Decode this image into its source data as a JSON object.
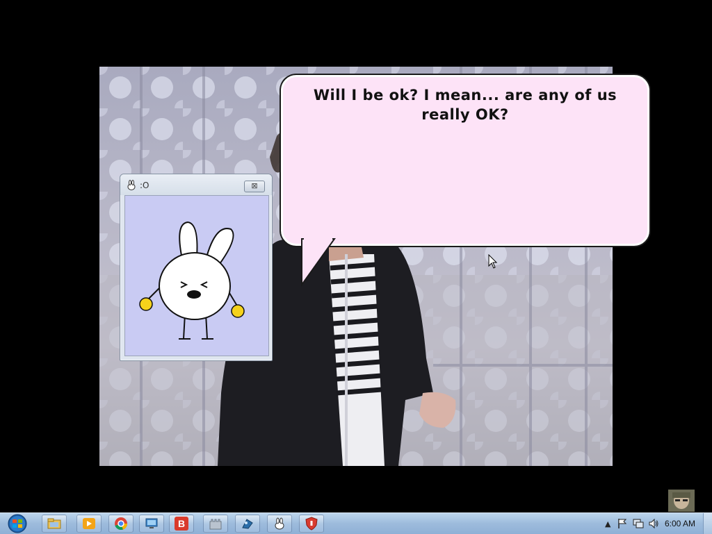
{
  "speech_bubble": {
    "text": "Will I be ok? I mean... are any of us really OK?"
  },
  "pet_window": {
    "title": ":O",
    "close_label": "⊠",
    "character": "white-bunny"
  },
  "taskbar": {
    "start_button": "start-orb-icon",
    "pinned_apps": [
      {
        "name": "explorer-icon"
      },
      {
        "name": "media-player-icon"
      },
      {
        "name": "chrome-icon"
      },
      {
        "name": "remote-desktop-icon"
      },
      {
        "name": "b-app-icon",
        "label": "B"
      },
      {
        "name": "castle-icon"
      },
      {
        "name": "puzzle-app-icon"
      },
      {
        "name": "bunny-app-icon"
      },
      {
        "name": "shield-app-icon"
      }
    ],
    "tray": {
      "clock": "6:00 AM"
    }
  },
  "colors": {
    "bubble_fill": "#fde3f7",
    "pet_background": "#c9cbf3",
    "taskbar": "#9dbbdc",
    "b_app": "#d93a2b"
  }
}
